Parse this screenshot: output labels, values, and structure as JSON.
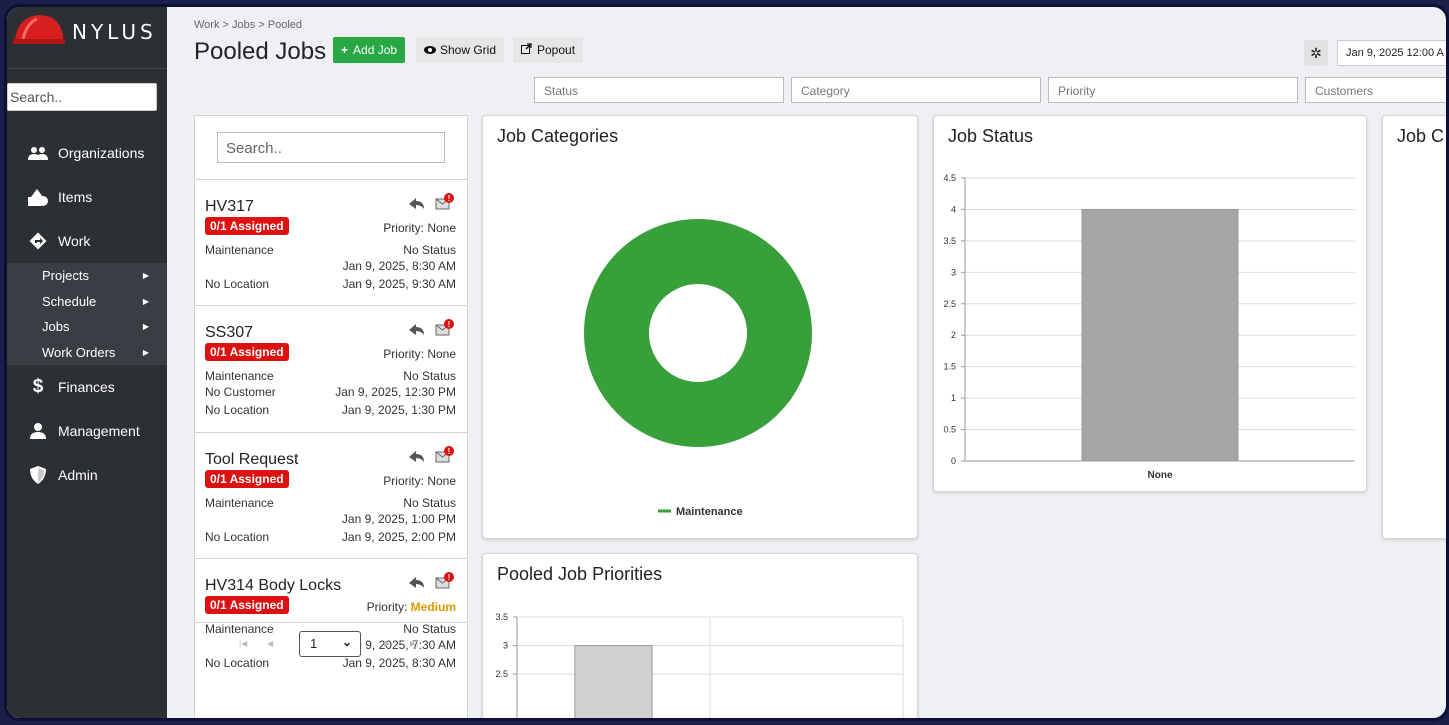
{
  "app": {
    "name": "NYLUS"
  },
  "sidebar": {
    "search_placeholder": "Search..",
    "items": [
      {
        "label": "Organizations",
        "icon": "users-icon"
      },
      {
        "label": "Items",
        "icon": "shapes-icon"
      },
      {
        "label": "Work",
        "icon": "diamond-arrow-icon"
      },
      {
        "label": "Finances",
        "icon": "dollar-icon"
      },
      {
        "label": "Management",
        "icon": "user-icon"
      },
      {
        "label": "Admin",
        "icon": "shield-icon"
      }
    ],
    "work_sub": [
      "Projects",
      "Schedule",
      "Jobs",
      "Work Orders"
    ]
  },
  "header": {
    "breadcrumb": "Work > Jobs > Pooled",
    "title": "Pooled Jobs",
    "add_job": "Add Job",
    "show_grid": "Show Grid",
    "popout": "Popout",
    "date": "Jan 9, 2025 12:00 A"
  },
  "filters": [
    "Status",
    "Category",
    "Priority",
    "Customers"
  ],
  "joblist": {
    "search_placeholder": "Search..",
    "jobs": [
      {
        "title": "HV317",
        "badge": "0/1 Assigned",
        "priority_label": "Priority:",
        "priority": "None",
        "category": "Maintenance",
        "status": "No Status",
        "customer": "",
        "start": "Jan 9, 2025, 8:30 AM",
        "location": "No Location",
        "end": "Jan 9, 2025, 9:30 AM"
      },
      {
        "title": "SS307",
        "badge": "0/1 Assigned",
        "priority_label": "Priority:",
        "priority": "None",
        "category": "Maintenance",
        "status": "No Status",
        "customer": "No Customer",
        "start": "Jan 9, 2025, 12:30 PM",
        "location": "No Location",
        "end": "Jan 9, 2025, 1:30 PM"
      },
      {
        "title": "Tool Request",
        "badge": "0/1 Assigned",
        "priority_label": "Priority:",
        "priority": "None",
        "category": "Maintenance",
        "status": "No Status",
        "customer": "",
        "start": "Jan 9, 2025, 1:00 PM",
        "location": "No Location",
        "end": "Jan 9, 2025, 2:00 PM"
      },
      {
        "title": "HV314 Body Locks",
        "badge": "0/1 Assigned",
        "priority_label": "Priority:",
        "priority": "Medium",
        "category": "Maintenance",
        "status": "No Status",
        "customer": "",
        "start": "Jan 9, 2025, 7:30 AM",
        "location": "No Location",
        "end": "Jan 9, 2025, 8:30 AM"
      }
    ],
    "page": "1"
  },
  "panels": {
    "categories_title": "Job Categories",
    "status_title": "Job Status",
    "third_title": "Job C",
    "priorities_title": "Pooled Job Priorities"
  },
  "colors": {
    "accent_green": "#28a745",
    "badge_red": "#dd1111",
    "donut_green": "#38a03a",
    "bar_gray": "#a6a6a6",
    "sidebar": "#2c2f33"
  },
  "chart_data": [
    {
      "type": "pie",
      "title": "Job Categories",
      "categories": [
        "Maintenance"
      ],
      "values": [
        1
      ],
      "legend": "bottom",
      "donut": true
    },
    {
      "type": "bar",
      "title": "Job Status",
      "categories": [
        "None"
      ],
      "values": [
        4
      ],
      "ylim": [
        0,
        4.5
      ],
      "yticks": [
        "0",
        "0.5",
        "1",
        "1.5",
        "2",
        "2.5",
        "3",
        "3.5",
        "4",
        "4.5"
      ],
      "grid": true
    },
    {
      "type": "bar",
      "title": "Pooled Job Priorities",
      "categories": [
        ""
      ],
      "values": [
        3
      ],
      "ylim": [
        0,
        3.5
      ],
      "yticks_visible": [
        "2.5",
        "3",
        "3.5"
      ],
      "grid": true
    }
  ]
}
